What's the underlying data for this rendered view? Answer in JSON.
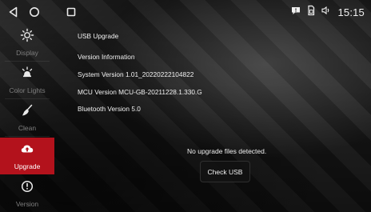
{
  "status_bar": {
    "time": "15:15",
    "icons": [
      "back-triangle-icon",
      "home-circle-icon",
      "recents-square-icon",
      "message-icon",
      "sim-card-icon",
      "volume-icon"
    ]
  },
  "sidebar": {
    "items": [
      {
        "label": "Display",
        "icon": "sun-icon",
        "active": false
      },
      {
        "label": "Color Lights",
        "icon": "lamp-icon",
        "active": false
      },
      {
        "label": "Clean",
        "icon": "broom-icon",
        "active": false
      },
      {
        "label": "Upgrade",
        "icon": "upload-icon",
        "active": true
      },
      {
        "label": "Version",
        "icon": "info-icon",
        "active": false
      }
    ]
  },
  "content": {
    "usb_upgrade": "USB Upgrade",
    "version_information": "Version Information",
    "system_version": "System Version 1.01_20220222104822",
    "mcu_version": "MCU Version MCU-GB-20211228.1.330.G",
    "bluetooth_version": "Bluetooth Version 5.0",
    "no_files_message": "No upgrade files detected.",
    "check_usb_label": "Check USB"
  },
  "colors": {
    "accent_active": "#b3121c",
    "text_primary": "#f2f2f2",
    "text_muted": "#7e7e7e"
  }
}
